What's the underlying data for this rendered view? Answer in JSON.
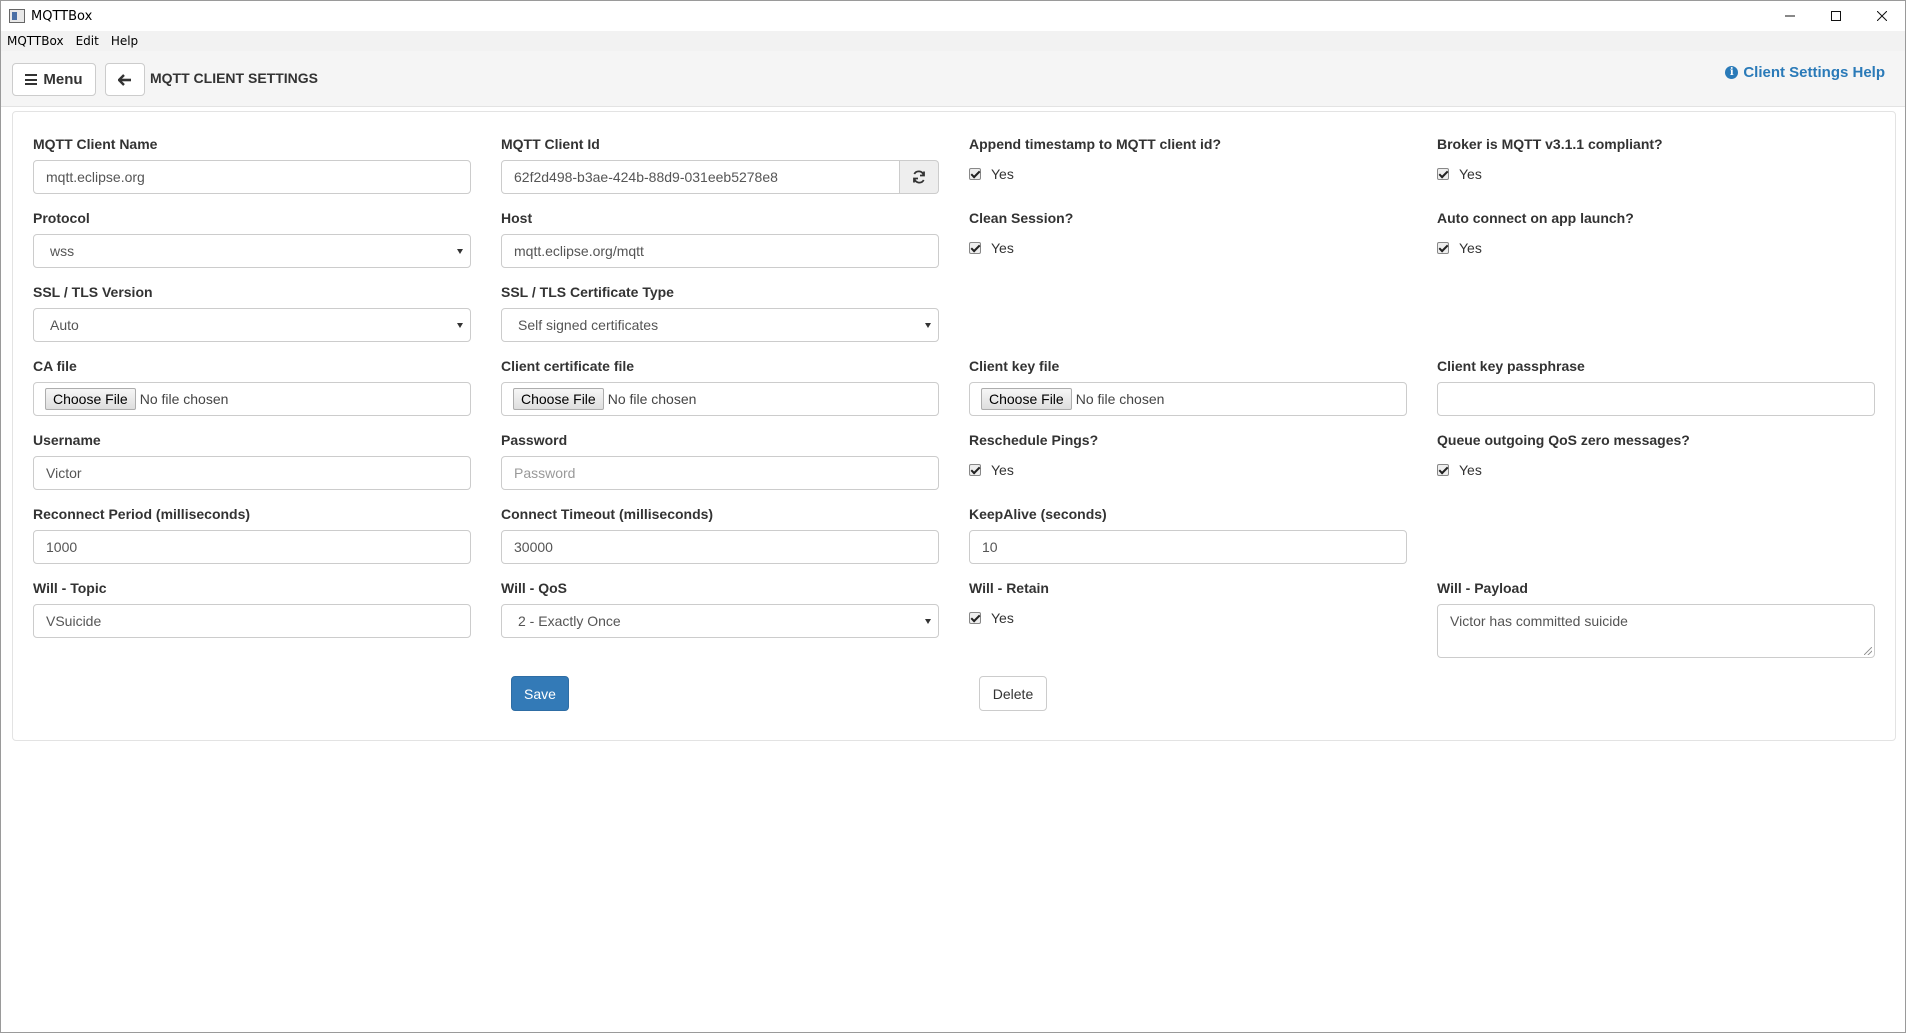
{
  "window": {
    "title": "MQTTBox",
    "minimize": "—",
    "maximize": "☐",
    "close": "✕"
  },
  "menubar": [
    "MQTTBox",
    "Edit",
    "Help"
  ],
  "header": {
    "menu_label": "Menu",
    "page_title": "MQTT CLIENT SETTINGS",
    "help_label": "Client Settings Help"
  },
  "form": {
    "client_name": {
      "label": "MQTT Client Name",
      "value": "mqtt.eclipse.org"
    },
    "client_id": {
      "label": "MQTT Client Id",
      "value": "62f2d498-b3ae-424b-88d9-031eeb5278e8"
    },
    "append_timestamp": {
      "label": "Append timestamp to MQTT client id?",
      "option": "Yes",
      "checked": true
    },
    "broker_compliant": {
      "label": "Broker is MQTT v3.1.1 compliant?",
      "option": "Yes",
      "checked": true
    },
    "protocol": {
      "label": "Protocol",
      "value": "wss"
    },
    "host": {
      "label": "Host",
      "value": "mqtt.eclipse.org/mqtt"
    },
    "clean_session": {
      "label": "Clean Session?",
      "option": "Yes",
      "checked": true
    },
    "auto_connect": {
      "label": "Auto connect on app launch?",
      "option": "Yes",
      "checked": true
    },
    "ssl_version": {
      "label": "SSL / TLS Version",
      "value": "Auto"
    },
    "ssl_cert_type": {
      "label": "SSL / TLS Certificate Type",
      "value": "Self signed certificates"
    },
    "ca_file": {
      "label": "CA file",
      "button": "Choose File",
      "status": "No file chosen"
    },
    "client_cert_file": {
      "label": "Client certificate file",
      "button": "Choose File",
      "status": "No file chosen"
    },
    "client_key_file": {
      "label": "Client key file",
      "button": "Choose File",
      "status": "No file chosen"
    },
    "client_key_passphrase": {
      "label": "Client key passphrase",
      "value": ""
    },
    "username": {
      "label": "Username",
      "value": "Victor"
    },
    "password": {
      "label": "Password",
      "placeholder": "Password"
    },
    "reschedule_pings": {
      "label": "Reschedule Pings?",
      "option": "Yes",
      "checked": true
    },
    "queue_qos_zero": {
      "label": "Queue outgoing QoS zero messages?",
      "option": "Yes",
      "checked": true
    },
    "reconnect_period": {
      "label": "Reconnect Period (milliseconds)",
      "value": "1000"
    },
    "connect_timeout": {
      "label": "Connect Timeout (milliseconds)",
      "value": "30000"
    },
    "keepalive": {
      "label": "KeepAlive (seconds)",
      "value": "10"
    },
    "will_topic": {
      "label": "Will - Topic",
      "value": "VSuicide"
    },
    "will_qos": {
      "label": "Will - QoS",
      "value": "2 - Exactly Once"
    },
    "will_retain": {
      "label": "Will - Retain",
      "option": "Yes",
      "checked": true
    },
    "will_payload": {
      "label": "Will - Payload",
      "value": "Victor has committed suicide"
    }
  },
  "actions": {
    "save": "Save",
    "delete": "Delete"
  },
  "colors": {
    "primary": "#337ab7",
    "link": "#2a7ab8"
  }
}
